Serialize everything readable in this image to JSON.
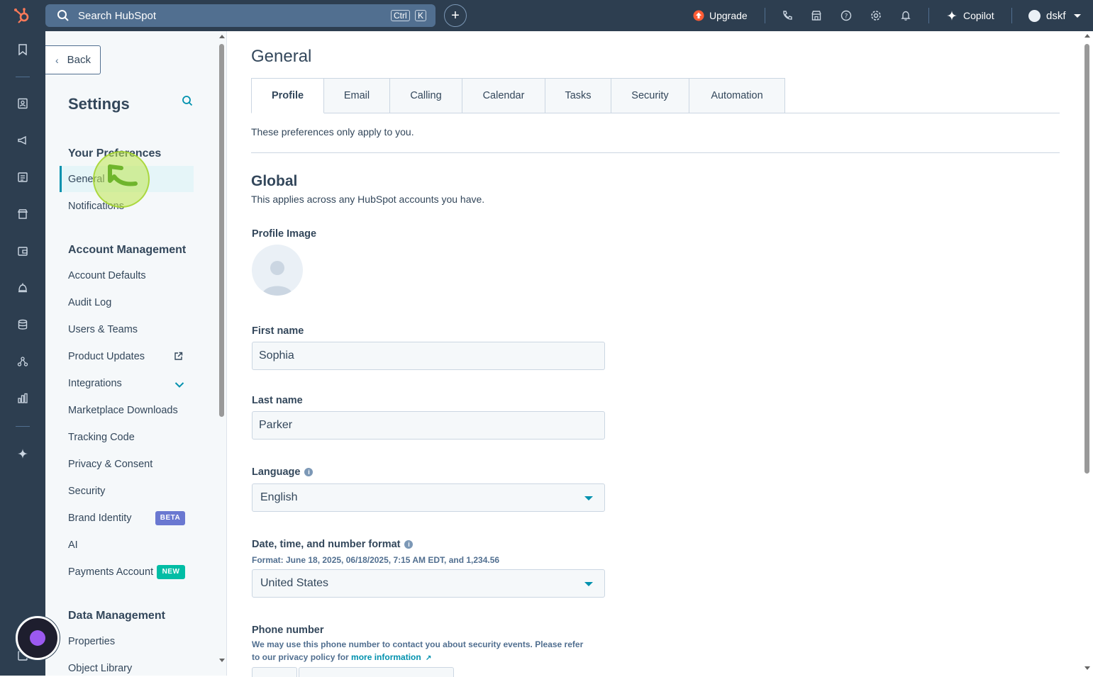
{
  "topbar": {
    "search_placeholder": "Search HubSpot",
    "kbd_ctrl": "Ctrl",
    "kbd_k": "K",
    "upgrade_label": "Upgrade",
    "copilot_label": "Copilot",
    "account_name": "dskf"
  },
  "sidebar": {
    "back_label": "Back",
    "title": "Settings",
    "sections": {
      "preferences": "Your Preferences",
      "account_management": "Account Management",
      "data_management": "Data Management"
    },
    "items": {
      "general": "General",
      "notifications": "Notifications",
      "account_defaults": "Account Defaults",
      "audit_log": "Audit Log",
      "users_teams": "Users & Teams",
      "product_updates": "Product Updates",
      "integrations": "Integrations",
      "marketplace_downloads": "Marketplace Downloads",
      "tracking_code": "Tracking Code",
      "privacy_consent": "Privacy & Consent",
      "security": "Security",
      "brand_identity": "Brand Identity",
      "ai": "AI",
      "payments_account": "Payments Account",
      "properties": "Properties",
      "object_library": "Object Library"
    },
    "badges": {
      "beta": "BETA",
      "new": "NEW"
    }
  },
  "main": {
    "title": "General",
    "tabs": [
      "Profile",
      "Email",
      "Calling",
      "Calendar",
      "Tasks",
      "Security",
      "Automation"
    ],
    "note": "These preferences only apply to you.",
    "global_heading": "Global",
    "global_sub": "This applies across any HubSpot accounts you have.",
    "profile_image_label": "Profile Image",
    "first_name_label": "First name",
    "first_name_value": "Sophia",
    "last_name_label": "Last name",
    "last_name_value": "Parker",
    "language_label": "Language",
    "language_value": "English",
    "date_format_label": "Date, time, and number format",
    "date_format_helper": "Format: June 18, 2025, 06/18/2025, 7:15 AM EDT, and 1,234.56",
    "date_format_value": "United States",
    "phone_label": "Phone number",
    "phone_helper_1": "We may use this phone number to contact you about security events. Please refer",
    "phone_helper_2": "to our privacy policy for ",
    "phone_helper_link": "more information"
  },
  "colors": {
    "topbar_bg": "#2d3e50",
    "accent": "#0091ae",
    "upgrade_orange": "#ff5c35",
    "beta_badge": "#6a78d1",
    "new_badge": "#00bda5"
  }
}
